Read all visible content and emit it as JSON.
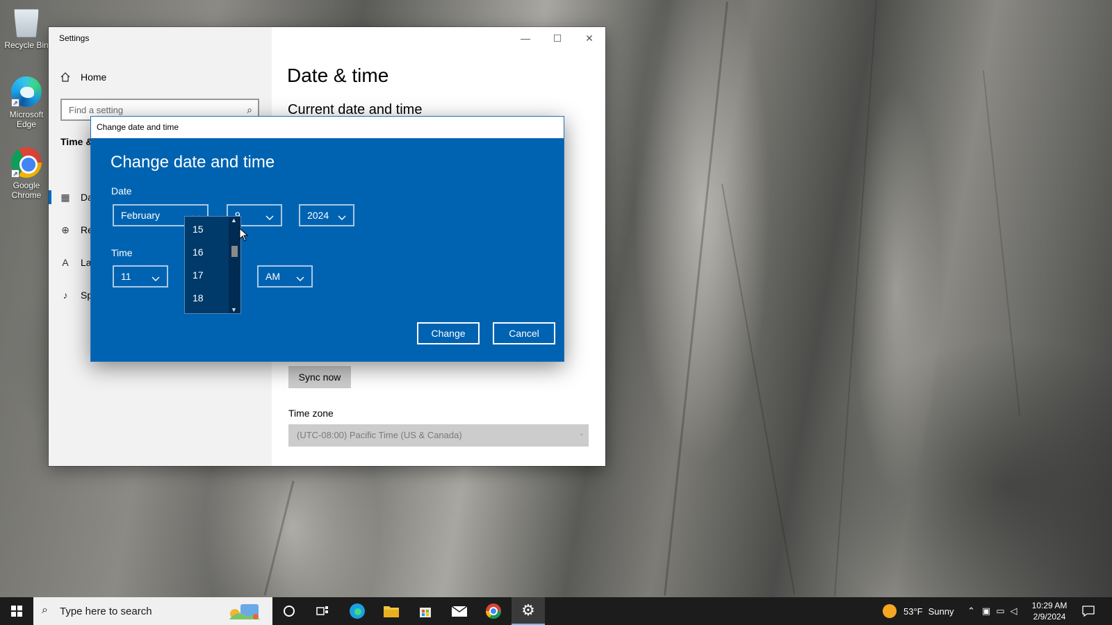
{
  "desktop": {
    "icons": [
      {
        "label": "Recycle Bin"
      },
      {
        "label": "Microsoft Edge"
      },
      {
        "label": "Google Chrome"
      }
    ]
  },
  "settings": {
    "window_title": "Settings",
    "controls": {
      "minimize": "—",
      "maximize": "☐",
      "close": "✕"
    },
    "sidebar": {
      "home_label": "Home",
      "search_placeholder": "Find a setting",
      "section_heading": "Time &",
      "items": [
        {
          "label": "Da",
          "icon": "calendar-icon"
        },
        {
          "label": "Re",
          "icon": "globe-icon"
        },
        {
          "label": "La",
          "icon": "language-icon"
        },
        {
          "label": "Sp",
          "icon": "microphone-icon"
        }
      ]
    },
    "main": {
      "title": "Date & time",
      "subtitle": "Current date and time",
      "sync_button": "Sync now",
      "timezone_label": "Time zone",
      "timezone_value": "(UTC-08:00) Pacific Time (US & Canada)"
    }
  },
  "dialog": {
    "window_title": "Change date and time",
    "heading": "Change date and time",
    "date_label": "Date",
    "month": "February",
    "day": "9",
    "year": "2024",
    "time_label": "Time",
    "hour": "11",
    "ampm": "AM",
    "change_button": "Change",
    "cancel_button": "Cancel",
    "day_dropdown": {
      "items": [
        "15",
        "16",
        "17",
        "18"
      ]
    }
  },
  "taskbar": {
    "search_placeholder": "Type here to search",
    "weather": {
      "temp": "53°F",
      "condition": "Sunny"
    },
    "clock": {
      "time": "10:29 AM",
      "date": "2/9/2024"
    }
  },
  "colors": {
    "dialog_blue": "#0063b1",
    "dropdown_bg": "#003a6b",
    "taskbar": "#1c1c1c",
    "accent": "#0067c0"
  }
}
